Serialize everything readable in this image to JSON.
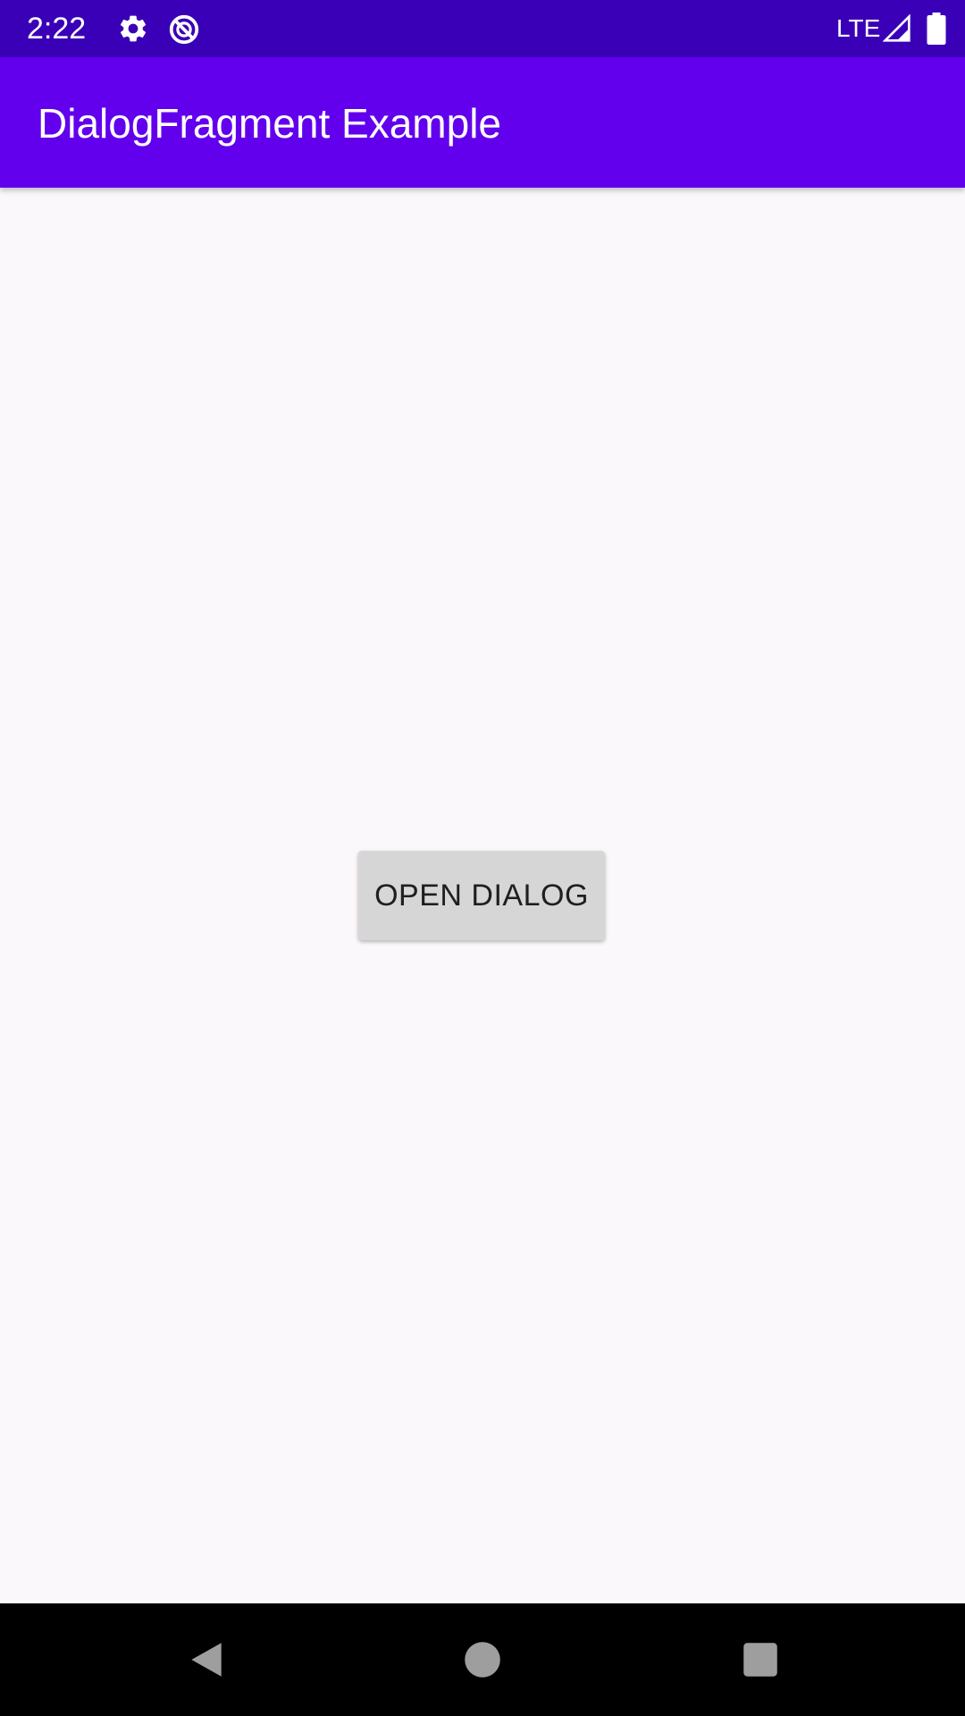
{
  "status_bar": {
    "time": "2:22",
    "network": "LTE",
    "icons": [
      "settings-icon",
      "no-disturb-icon",
      "signal-icon",
      "battery-icon"
    ]
  },
  "app_bar": {
    "title": "DialogFragment Example"
  },
  "main": {
    "open_dialog_label": "OPEN DIALOG"
  },
  "nav_bar": {
    "icons": [
      "back-icon",
      "home-icon",
      "recents-icon"
    ]
  },
  "colors": {
    "status_bar": "#3a00b8",
    "app_bar": "#6200ee",
    "background": "#fbf8fc",
    "button": "#d6d6d6",
    "nav_bar": "#000000"
  }
}
